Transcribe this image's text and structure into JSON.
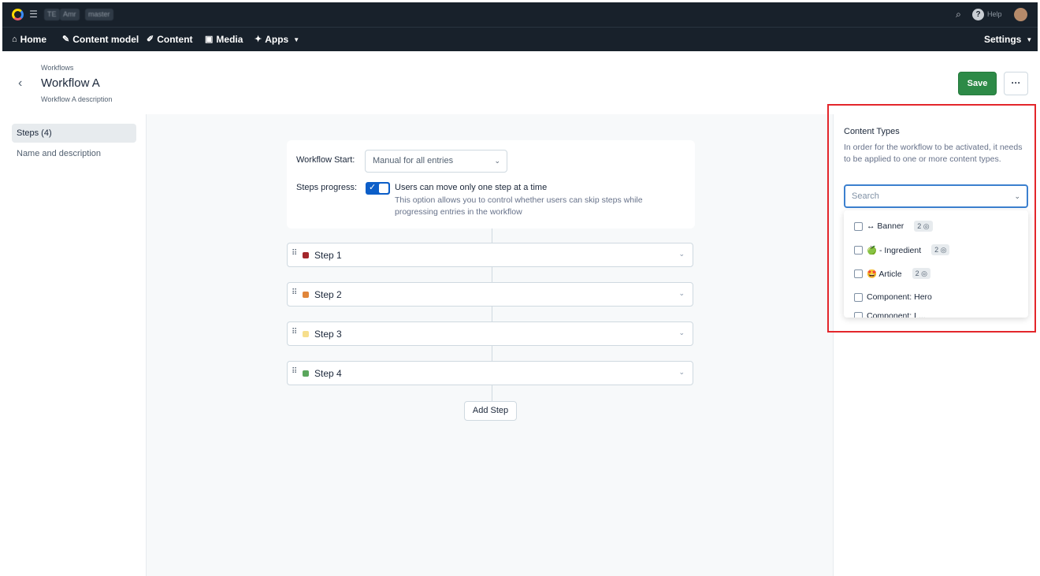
{
  "topbar": {
    "chips": [
      "TE",
      "Amr",
      "master"
    ],
    "help_label": "Help"
  },
  "nav": {
    "items": [
      {
        "label": "Home",
        "icon": "home-icon"
      },
      {
        "label": "Content model",
        "icon": "wrench-icon"
      },
      {
        "label": "Content",
        "icon": "pencil-icon"
      },
      {
        "label": "Media",
        "icon": "image-icon"
      },
      {
        "label": "Apps",
        "icon": "puzzle-icon"
      }
    ],
    "settings_label": "Settings"
  },
  "header": {
    "breadcrumb": "Workflows",
    "title": "Workflow A",
    "description": "Workflow A description",
    "save_label": "Save",
    "more_label": "···"
  },
  "sidebar": {
    "items": [
      {
        "label": "Steps (4)",
        "active": true
      },
      {
        "label": "Name and description",
        "active": false
      }
    ]
  },
  "settings": {
    "start_label": "Workflow Start:",
    "start_value": "Manual for all entries",
    "progress_label": "Steps progress:",
    "progress_enabled": true,
    "progress_title": "Users can move only one step at a time",
    "progress_help": "This option allows you to control whether users can skip steps while progressing entries in the workflow"
  },
  "steps": [
    {
      "name": "Step 1",
      "color": "#a3262b"
    },
    {
      "name": "Step 2",
      "color": "#e0853a"
    },
    {
      "name": "Step 3",
      "color": "#f6de8c"
    },
    {
      "name": "Step 4",
      "color": "#5aa65c"
    }
  ],
  "add_step_label": "Add Step",
  "content_types": {
    "title": "Content Types",
    "help": "In order for the workflow to be activated, it needs to be applied to one or more content types.",
    "search_placeholder": "Search",
    "options": [
      {
        "label": "↔ Banner",
        "count": "2"
      },
      {
        "label": "🍏 - Ingredient",
        "count": "2"
      },
      {
        "label": "🤩 Article",
        "count": "2"
      },
      {
        "label": "Component: Hero",
        "count": ""
      },
      {
        "label": "Component: L...",
        "count": ""
      }
    ]
  },
  "colors": {
    "brand_green": "#2d8a47",
    "nav_bg": "#18212b",
    "highlight_red": "#e3262b",
    "toggle_blue": "#0c5ec8"
  }
}
